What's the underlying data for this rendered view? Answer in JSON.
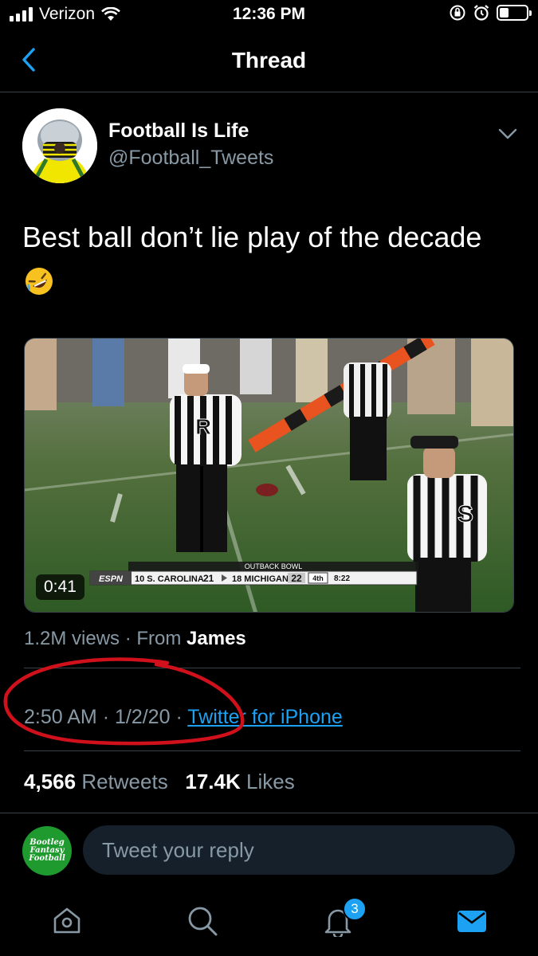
{
  "status_bar": {
    "carrier": "Verizon",
    "time": "12:36 PM",
    "signal_bars": 4,
    "battery_level": 0.35
  },
  "nav": {
    "title": "Thread",
    "back_icon": "chevron-left-icon"
  },
  "tweet": {
    "author_name": "Football Is Life",
    "author_handle": "@Football_Tweets",
    "text": "Best ball don’t lie play of the decade",
    "emoji": "rolling-on-floor-laughing-emoji",
    "media": {
      "duration": "0:41",
      "scorebug": {
        "bowl": "OUTBACK BOWL",
        "network": "ESPN",
        "team1_rank": "10",
        "team1": "S. CAROLINA",
        "team1_score": "21",
        "team2_rank": "18",
        "team2": "MICHIGAN",
        "team2_score": "22",
        "quarter": "4th",
        "clock": "8:22"
      }
    },
    "views": "1.2M views",
    "views_sep": " · From ",
    "views_from": "James",
    "time": "2:50 AM",
    "date": "1/2/20",
    "source": "Twitter for iPhone",
    "retweets_count": "4,566",
    "retweets_label": "Retweets",
    "likes_count": "17.4K",
    "likes_label": "Likes"
  },
  "reply": {
    "placeholder": "Tweet your reply",
    "avatar_text_1": "Bootleg",
    "avatar_text_2": "Fantasy",
    "avatar_text_3": "Football"
  },
  "tabbar": {
    "items": [
      "home-icon",
      "search-icon",
      "notifications-icon",
      "messages-icon"
    ],
    "notification_badge": "3"
  },
  "colors": {
    "background": "#000000",
    "accent": "#1da1f2",
    "secondary_text": "#8899a6",
    "annotation": "#d0101a"
  }
}
